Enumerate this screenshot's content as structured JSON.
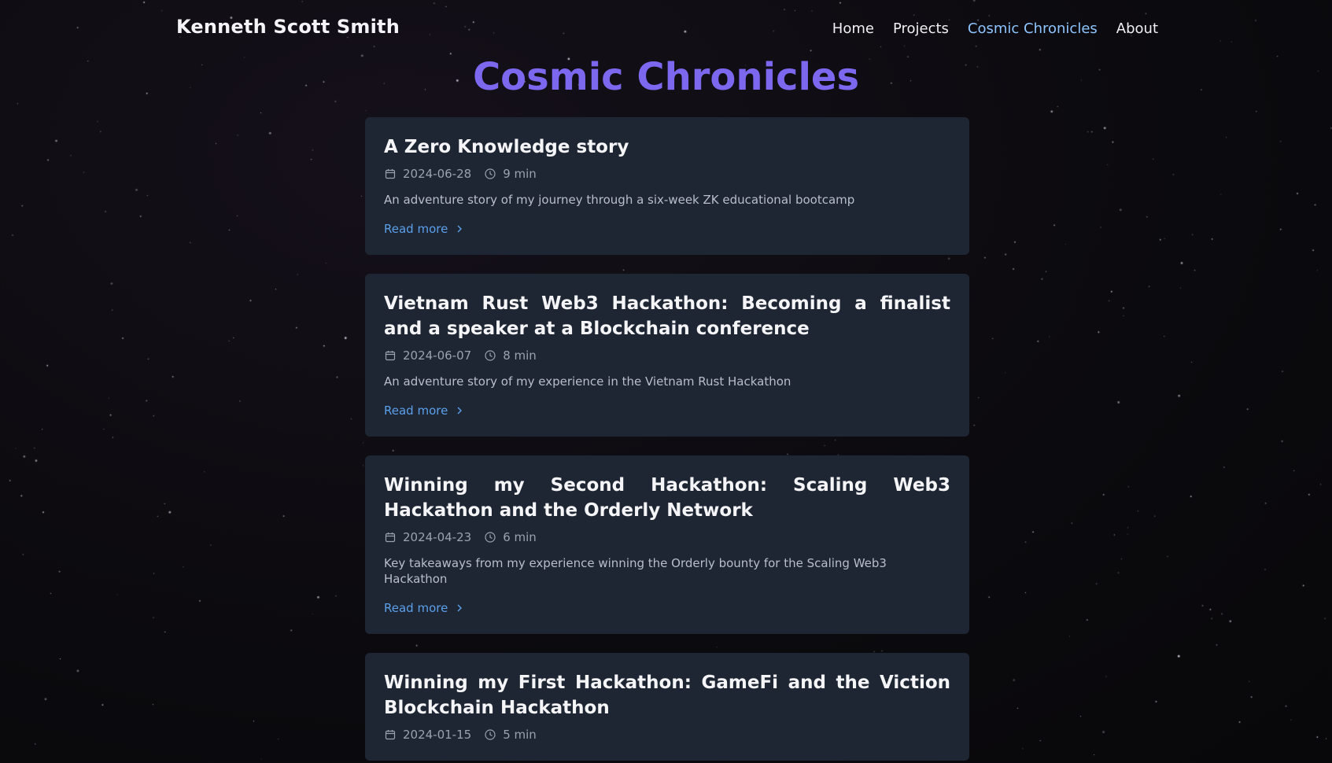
{
  "header": {
    "brand": "Kenneth Scott Smith",
    "nav": [
      {
        "label": "Home",
        "active": false
      },
      {
        "label": "Projects",
        "active": false
      },
      {
        "label": "Cosmic Chronicles",
        "active": true
      },
      {
        "label": "About",
        "active": false
      }
    ]
  },
  "page": {
    "title": "Cosmic Chronicles"
  },
  "posts": [
    {
      "title": "A Zero Knowledge story",
      "date": "2024-06-28",
      "read_time": "9 min",
      "description": "An adventure story of my journey through a six-week ZK educational bootcamp",
      "read_more": "Read more"
    },
    {
      "title": "Vietnam Rust Web3 Hackathon: Becoming a finalist and a speaker at a Blockchain conference",
      "date": "2024-06-07",
      "read_time": "8 min",
      "description": "An adventure story of my experience in the Vietnam Rust Hackathon",
      "read_more": "Read more"
    },
    {
      "title": "Winning my Second Hackathon: Scaling Web3 Hackathon and the Orderly Network",
      "date": "2024-04-23",
      "read_time": "6 min",
      "description": "Key takeaways from my experience winning the Orderly bounty for the Scaling Web3 Hackathon",
      "read_more": "Read more"
    },
    {
      "title": "Winning my First Hackathon: GameFi and the Viction Blockchain Hackathon",
      "date": "2024-01-15",
      "read_time": "5 min",
      "description": "",
      "read_more": ""
    }
  ],
  "colors": {
    "background": "#0d0b10",
    "card": "#1e2533",
    "title_accent": "#7b68ee",
    "nav_active": "#8ec5ff",
    "link": "#5aa0ea"
  },
  "icons": {
    "date": "calendar-icon",
    "time": "clock-icon",
    "read_more": "chevron-right-icon"
  }
}
